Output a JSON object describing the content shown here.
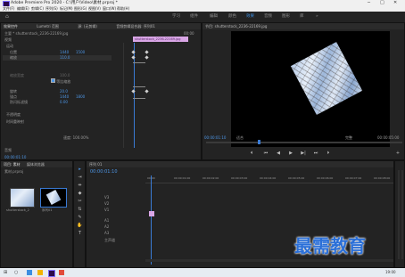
{
  "window": {
    "title": "Adobe Premiere Pro 2020 - C:\\用户\\Video\\素材.prproj *",
    "minimize": "─",
    "maximize": "□",
    "close": "✕"
  },
  "menu": [
    "文件(F)",
    "编辑(E)",
    "剪辑(C)",
    "序列(S)",
    "标记(M)",
    "图形(G)",
    "视图(V)",
    "窗口(W)",
    "帮助(H)"
  ],
  "workspaces": {
    "home": "⌂",
    "items": [
      "学习",
      "组件",
      "编辑",
      "颜色",
      "效果",
      "音频",
      "图形",
      "库"
    ],
    "active": "效果",
    "more": "»"
  },
  "effect_controls": {
    "tabs": [
      "效果控件",
      "Lumetri 范围",
      "源: (无剪辑)",
      "音频剪辑混合器: 序列01"
    ],
    "source_label": "主要 * shutterstock_2236-22169.jpg",
    "clip_label": "shutterstock_2236-22169.jpg",
    "timecode_top": "00:00",
    "section_video": "视频",
    "fx_motion": "运动",
    "rows": [
      {
        "name": "位置",
        "v1": "1440",
        "v2": "1500"
      },
      {
        "name": "缩放",
        "v1": "110.0",
        "v2": ""
      },
      {
        "name": "缩放宽度",
        "v1": "100.0",
        "v2": ""
      },
      {
        "name": "等比缩放",
        "v1": "",
        "v2": ""
      },
      {
        "name": "旋转",
        "v1": "20.0",
        "v2": ""
      },
      {
        "name": "锚点",
        "v1": "1440",
        "v2": "1800"
      },
      {
        "name": "防闪烁滤镜",
        "v1": "0.00",
        "v2": ""
      }
    ],
    "opacity_fx": "不透明度",
    "time_remap": "时间重映射",
    "audio": "音频",
    "timecode_bottom": "00:00:01:10",
    "duration_label": "速度: 100.00%"
  },
  "program": {
    "title": "节目: shutterstock_2236-22169.jpg",
    "timecode": "00:00:01:10",
    "fit": "适合",
    "quality": "完整",
    "duration": "00:00:05:00",
    "controls": [
      "⏴",
      "⏮",
      "◀",
      "▶",
      "▶|",
      "⏭",
      "⏵",
      "+",
      "⬚",
      "▣",
      "📷"
    ]
  },
  "project": {
    "title": "项目: 素材",
    "tab2": "媒体浏览器",
    "path": "素材.prproj",
    "items": [
      {
        "name": "shutterstock_2",
        "dur": "5:00"
      },
      {
        "name": "序列01",
        "dur": "5:00"
      }
    ]
  },
  "timeline": {
    "title": "序列 01",
    "timecode": "00:00:01:10",
    "ruler": [
      "00:00",
      "00:00:01:00",
      "00:00:02:00",
      "00:00:03:00",
      "00:00:04:00",
      "00:00:05:00",
      "00:00:06:00",
      "00:00:07:00",
      "00:00:08:00"
    ],
    "tracks": [
      "V3",
      "V2",
      "V1",
      "A1",
      "A2",
      "A3"
    ],
    "master": "主声道"
  },
  "tools": [
    "▸",
    "⇥",
    "⇹",
    "◆",
    "✂",
    "⇅",
    "✎",
    "✋",
    "T"
  ],
  "watermark": "最需教育",
  "taskbar": {
    "start": "⊞",
    "search": "○",
    "time": "19:00"
  }
}
